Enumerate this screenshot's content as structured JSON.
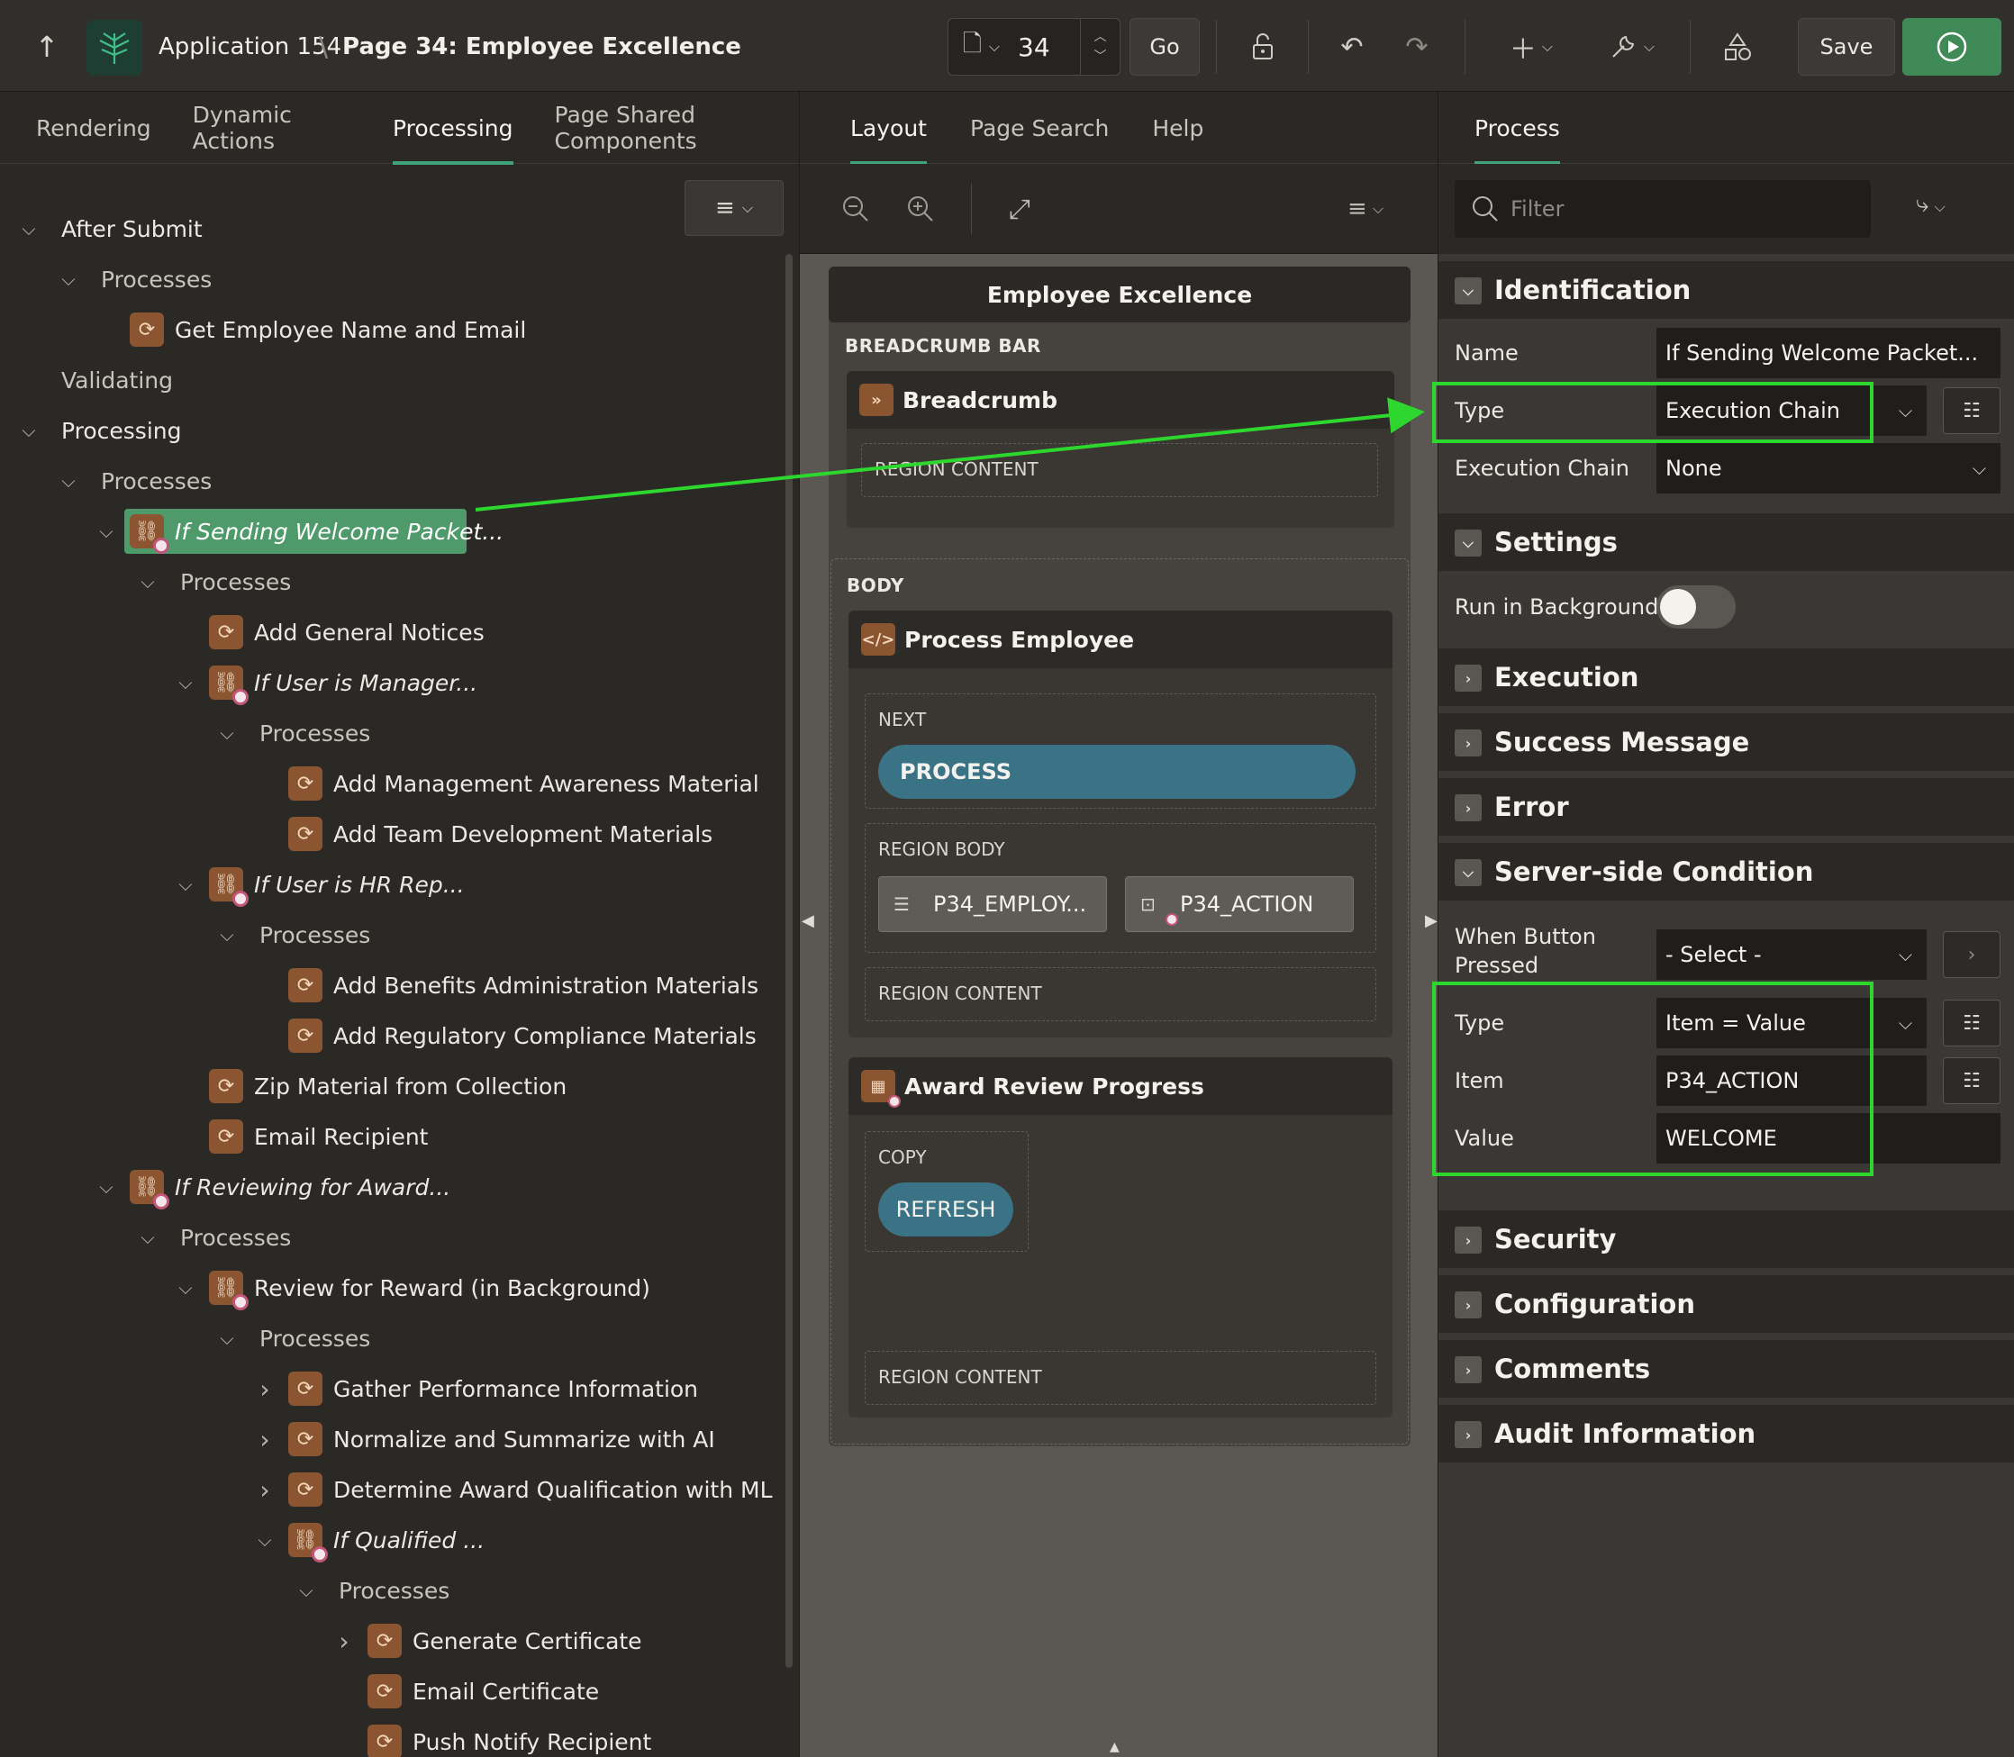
{
  "header": {
    "app_name": "Application 154",
    "separator": "\\",
    "page_title": "Page 34: Employee Excellence",
    "page_number": "34",
    "go_label": "Go",
    "save_label": "Save"
  },
  "left_panel": {
    "tabs": [
      "Rendering",
      "Dynamic Actions",
      "Processing",
      "Page Shared Components"
    ],
    "active_tab": "Processing",
    "tree": [
      {
        "label": "After Submit",
        "level": 0
      },
      {
        "label": "Processes",
        "level": 1
      },
      {
        "label": "Get Employee Name and Email",
        "level": 2
      },
      {
        "label": "Validating",
        "level": 0
      },
      {
        "label": "Processing",
        "level": 0
      },
      {
        "label": "Processes",
        "level": 1
      },
      {
        "label": "If Sending Welcome Packet...",
        "level": 2
      },
      {
        "label": "Processes",
        "level": 3
      },
      {
        "label": "Add General Notices",
        "level": 4
      },
      {
        "label": "If User is Manager...",
        "level": 4
      },
      {
        "label": "Processes",
        "level": 5
      },
      {
        "label": "Add Management Awareness Material",
        "level": 6
      },
      {
        "label": "Add Team Development Materials",
        "level": 6
      },
      {
        "label": "If User is HR Rep...",
        "level": 4
      },
      {
        "label": "Processes",
        "level": 5
      },
      {
        "label": "Add Benefits Administration Materials",
        "level": 6
      },
      {
        "label": "Add Regulatory Compliance Materials",
        "level": 6
      },
      {
        "label": "Zip Material from Collection",
        "level": 4
      },
      {
        "label": "Email Recipient",
        "level": 4
      },
      {
        "label": "If Reviewing for Award...",
        "level": 2
      },
      {
        "label": "Processes",
        "level": 3
      },
      {
        "label": "Review for Reward (in Background)",
        "level": 4
      },
      {
        "label": "Processes",
        "level": 5
      },
      {
        "label": "Gather Performance Information",
        "level": 6
      },
      {
        "label": "Normalize and Summarize with AI",
        "level": 6
      },
      {
        "label": "Determine Award Qualification with ML",
        "level": 6
      },
      {
        "label": "If Qualified ...",
        "level": 6
      },
      {
        "label": "Processes",
        "level": 7
      },
      {
        "label": "Generate Certificate",
        "level": 8
      },
      {
        "label": "Email Certificate",
        "level": 8
      },
      {
        "label": "Push Notify Recipient",
        "level": 8
      }
    ]
  },
  "middle_panel": {
    "tabs": [
      "Layout",
      "Page Search",
      "Help"
    ],
    "active_tab": "Layout",
    "page_name": "Employee Excellence",
    "breadcrumb_bar_label": "BREADCRUMB BAR",
    "breadcrumb_region": "Breadcrumb",
    "region_content_label": "REGION CONTENT",
    "body_label": "BODY",
    "process_region": "Process Employee",
    "next_label": "NEXT",
    "process_button": "PROCESS",
    "region_body_label": "REGION BODY",
    "item_1": "P34_EMPLOY...",
    "item_2": "P34_ACTION",
    "award_region": "Award Review Progress",
    "copy_label": "COPY",
    "refresh_button": "REFRESH"
  },
  "right_panel": {
    "tab": "Process",
    "filter_placeholder": "Filter",
    "groups": {
      "identification": "Identification",
      "settings": "Settings",
      "execution": "Execution",
      "success_message": "Success Message",
      "error": "Error",
      "server_side_condition": "Server-side Condition",
      "security": "Security",
      "configuration": "Configuration",
      "comments": "Comments",
      "audit_information": "Audit Information"
    },
    "props": {
      "name_label": "Name",
      "name_value": "If Sending Welcome Packet...",
      "type_label": "Type",
      "type_value": "Execution Chain",
      "exec_chain_label": "Execution Chain",
      "exec_chain_value": "None",
      "run_bg_label": "Run in Background",
      "when_button_label_1": "When Button",
      "when_button_label_2": "Pressed",
      "when_button_value": "- Select -",
      "cond_type_label": "Type",
      "cond_type_value": "Item = Value",
      "item_label": "Item",
      "item_value": "P34_ACTION",
      "value_label": "Value",
      "value_value": "WELCOME"
    }
  },
  "colors": {
    "accent_green": "#3fa37a",
    "highlight_green": "#2ed72e",
    "selected_node": "#4f9a6b",
    "run_button": "#3f8a57",
    "process_icon": "#8a5530",
    "button_teal": "#3a7386"
  },
  "icons": [
    "up-arrow-icon",
    "apex-logo-icon",
    "page-icon",
    "unlock-icon",
    "undo-icon",
    "redo-icon",
    "plus-icon",
    "wrench-icon",
    "shapes-icon",
    "run-icon",
    "menu-icon",
    "zoom-out-icon",
    "zoom-in-icon",
    "expand-icon",
    "search-icon",
    "goto-icon",
    "process-icon",
    "chain-icon",
    "breadcrumb-icon",
    "code-icon",
    "grid-icon",
    "list-icon"
  ]
}
